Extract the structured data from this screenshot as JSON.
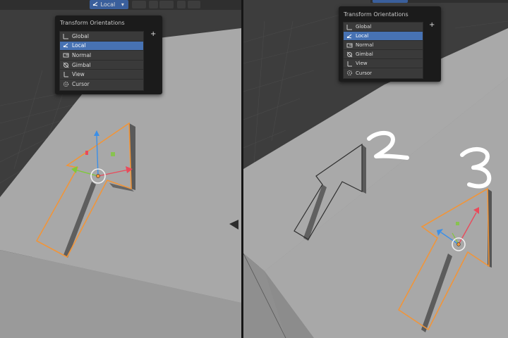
{
  "header": {
    "orientation_value": "Local",
    "chevron": "▾"
  },
  "dropdown": {
    "title": "Transform Orientations",
    "add_label": "+",
    "items": [
      {
        "label": "Global",
        "icon": "global-orientation-icon",
        "selected": false
      },
      {
        "label": "Local",
        "icon": "local-orientation-icon",
        "selected": true
      },
      {
        "label": "Normal",
        "icon": "normal-orientation-icon",
        "selected": false
      },
      {
        "label": "Gimbal",
        "icon": "gimbal-orientation-icon",
        "selected": false
      },
      {
        "label": "View",
        "icon": "view-orientation-icon",
        "selected": false
      },
      {
        "label": "Cursor",
        "icon": "cursor-orientation-icon",
        "selected": false
      }
    ]
  },
  "annotations": [
    "2",
    "3"
  ],
  "colors": {
    "header_button": "#3a5f9c",
    "selected_item": "#4772b3",
    "selection_outline": "#f0953a",
    "axis_x": "#e94b5b",
    "axis_y": "#7fc93a",
    "axis_z": "#3b8fe8",
    "plane": "#a7a7a7",
    "viewport": "#3c3c3c"
  }
}
